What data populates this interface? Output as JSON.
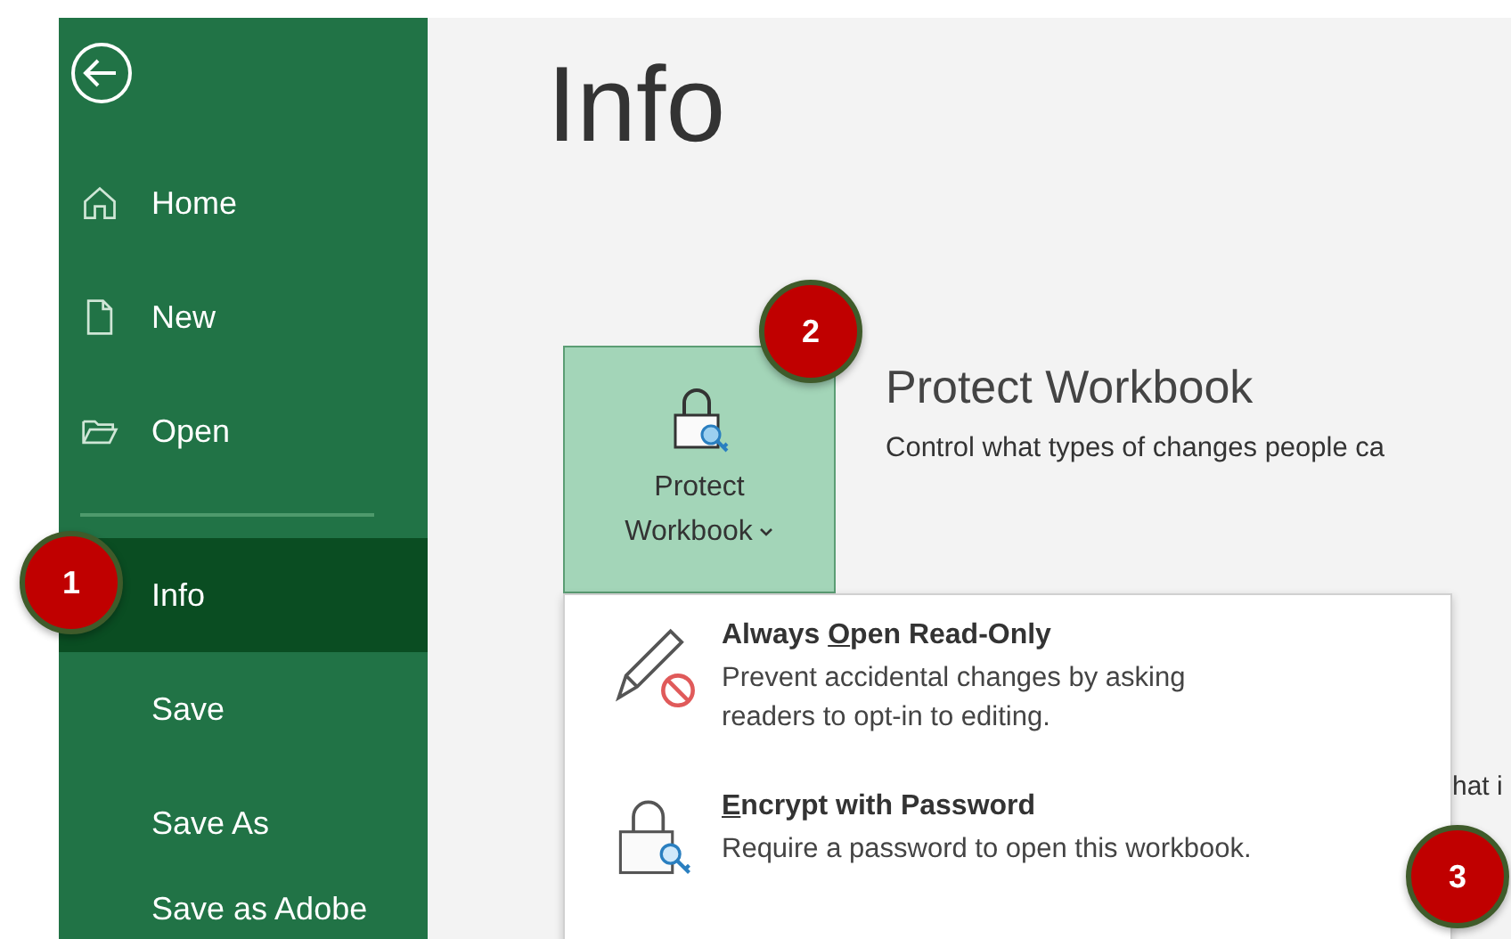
{
  "sidebar": {
    "items": [
      {
        "label": "Home",
        "selected": false
      },
      {
        "label": "New",
        "selected": false
      },
      {
        "label": "Open",
        "selected": false
      },
      {
        "label": "Info",
        "selected": true
      },
      {
        "label": "Save",
        "selected": false
      },
      {
        "label": "Save As",
        "selected": false
      },
      {
        "label": "Save as Adobe",
        "selected": false
      }
    ]
  },
  "page_title": "Info",
  "protect": {
    "button_label": "Protect\nWorkbook",
    "heading": "Protect Workbook",
    "description": "Control what types of changes people ca"
  },
  "menu": [
    {
      "kind": "pencil",
      "title_before": "Always ",
      "title_key": "O",
      "title_after": "pen Read-Only",
      "description": "Prevent accidental changes by asking\nreaders to opt-in to editing."
    },
    {
      "kind": "lock",
      "title_key": "E",
      "title_after": "ncrypt with Password",
      "description": "Require a password to open this workbook."
    }
  ],
  "background_text": "hat i",
  "callouts": [
    "1",
    "2",
    "3"
  ]
}
